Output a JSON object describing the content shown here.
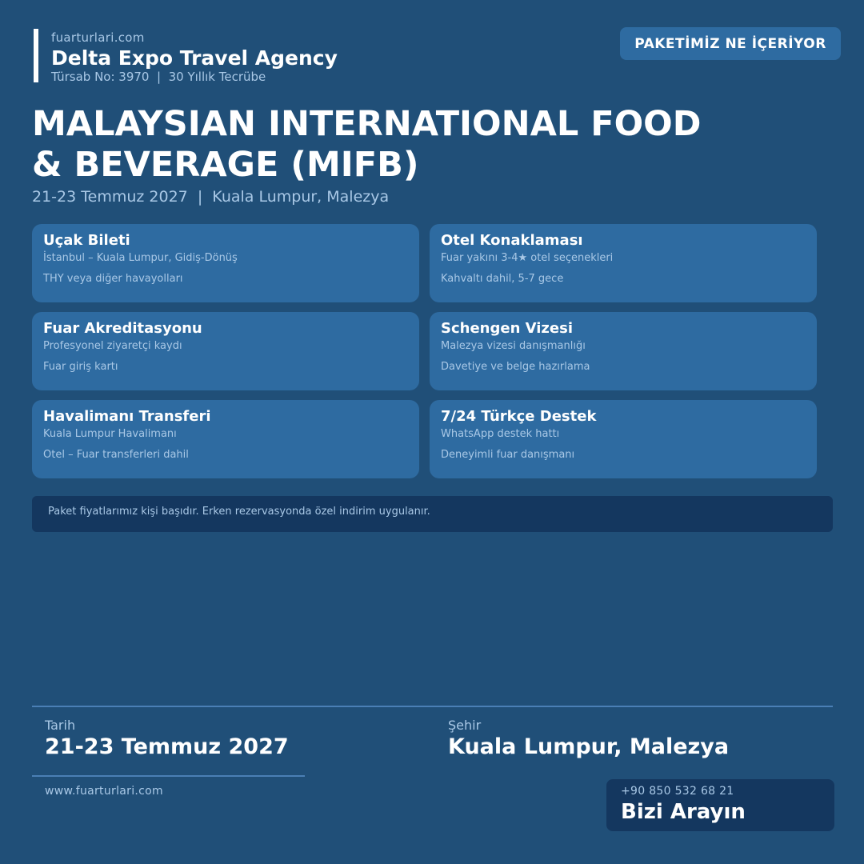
{
  "brand": {
    "site": "fuarturlari.com",
    "name": "Delta Expo Travel Agency",
    "info": "Türsab No: 3970  |  30 Yıllık Tecrübe"
  },
  "badge": {
    "label": "PAKETİMİZ NE İÇERİYOR"
  },
  "event": {
    "title_line1": "MALAYSIAN INTERNATIONAL FOOD",
    "title_line2": "& BEVERAGE (MIFB)",
    "subtitle": "21-23 Temmuz 2027  |  Kuala Lumpur, Malezya"
  },
  "cards": [
    {
      "title": "Uçak Bileti",
      "line1": "İstanbul – Kuala Lumpur, Gidiş-Dönüş",
      "line2": "THY veya diğer havayolları"
    },
    {
      "title": "Otel Konaklaması",
      "line1": "Fuar yakını 3-4★ otel seçenekleri",
      "line2": "Kahvaltı dahil, 5-7 gece"
    },
    {
      "title": "Fuar Akreditasyonu",
      "line1": "Profesyonel ziyaretçi kaydı",
      "line2": "Fuar giriş kartı"
    },
    {
      "title": "Schengen Vizesi",
      "line1": "Malezya vizesi danışmanlığı",
      "line2": "Davetiye ve belge hazırlama"
    },
    {
      "title": "Havalimanı Transferi",
      "line1": "Kuala Lumpur Havalimanı",
      "line2": "Otel – Fuar transferleri dahil"
    },
    {
      "title": "7/24 Türkçe Destek",
      "line1": "WhatsApp destek hattı",
      "line2": "Deneyimli fuar danışmanı"
    }
  ],
  "note": "Paket fiyatlarımız kişi başıdır. Erken rezervasyonda özel indirim uygulanır.",
  "footer": {
    "date_label": "Tarih",
    "date_value": "21-23 Temmuz 2027",
    "city_label": "Şehir",
    "city_value": "Kuala Lumpur, Malezya",
    "website": "www.fuarturlari.com",
    "phone": "+90 850 532 68 21",
    "call_label": "Bizi Arayın"
  },
  "colors": {
    "background": "#204f78",
    "card": "#2e6ba1",
    "dark_panel": "#14375f",
    "muted_text": "#a9c8e6",
    "divider": "#4a7fb5"
  }
}
